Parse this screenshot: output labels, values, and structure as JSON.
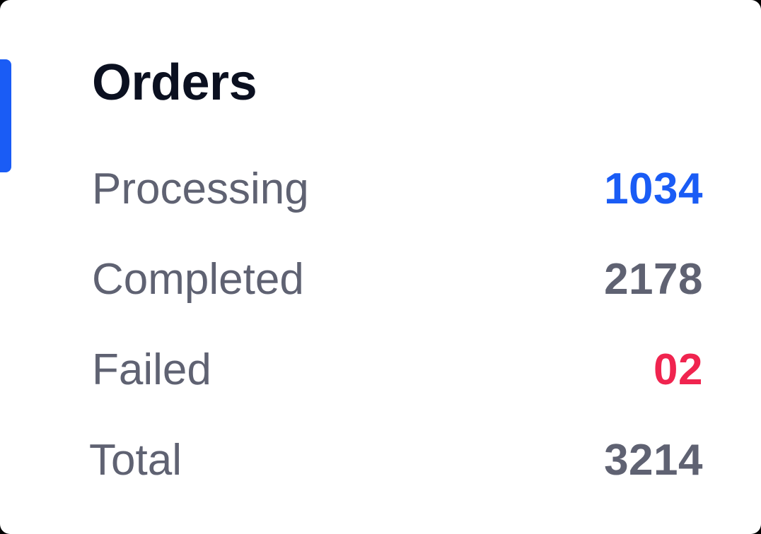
{
  "card": {
    "title": "Orders",
    "accent_color": "#1a5cf5",
    "rows": [
      {
        "label": "Processing",
        "value": "1034",
        "color": "#1a5cf5"
      },
      {
        "label": "Completed",
        "value": "2178",
        "color": "#5f6272"
      },
      {
        "label": "Failed",
        "value": "02",
        "color": "#f0244f"
      },
      {
        "label": "Total",
        "value": "3214",
        "color": "#5f6272"
      }
    ]
  }
}
